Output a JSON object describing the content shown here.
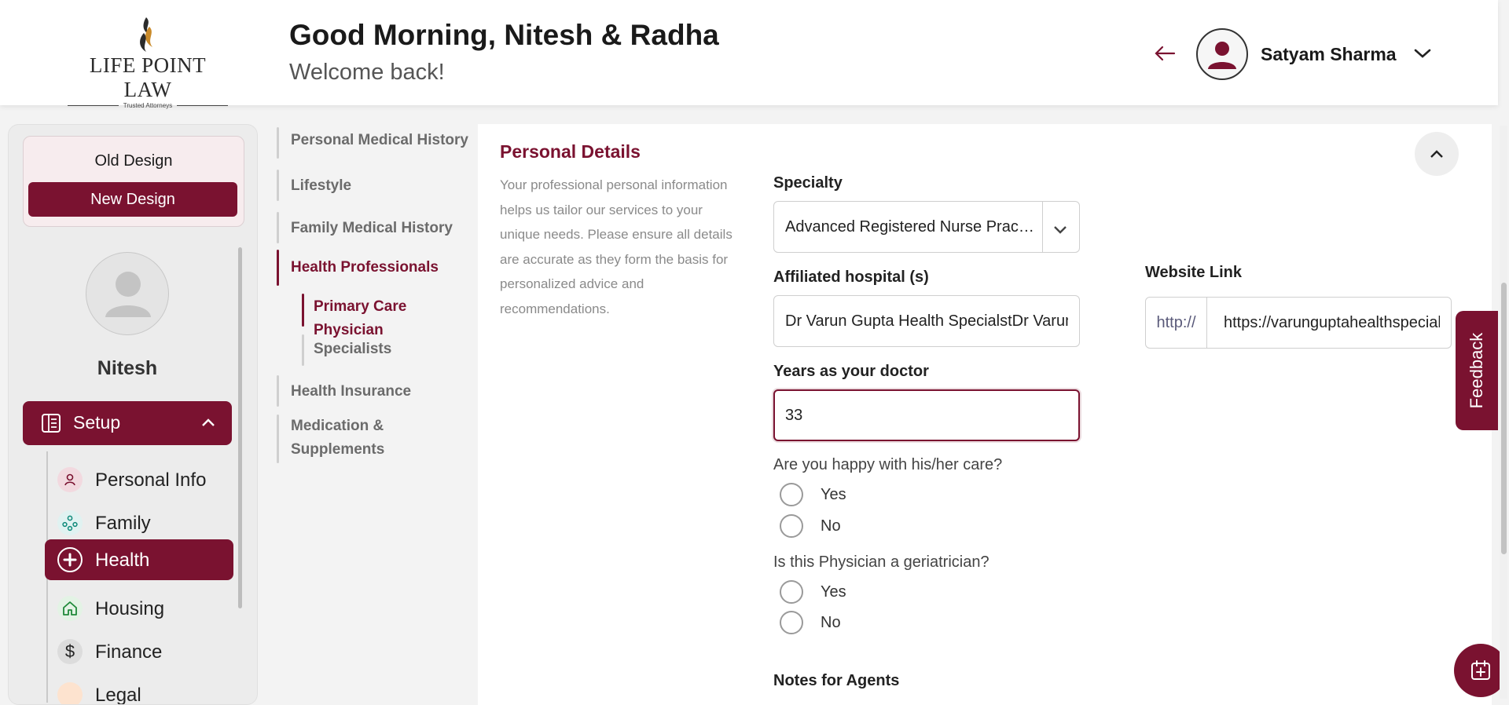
{
  "brand": {
    "logo_text": "LIFE POINT LAW",
    "logo_tagline": "Trusted Attorneys"
  },
  "header": {
    "greeting": "Good Morning, Nitesh & Radha",
    "welcome": "Welcome back!",
    "user_name": "Satyam Sharma"
  },
  "design_toggle": {
    "old": "Old Design",
    "new": "New Design"
  },
  "profile": {
    "name": "Nitesh"
  },
  "sidebar": {
    "setup_label": "Setup",
    "items": [
      {
        "label": "Personal Info",
        "icon": "person-icon"
      },
      {
        "label": "Family",
        "icon": "family-icon"
      },
      {
        "label": "Health",
        "icon": "health-cross-icon",
        "active": true
      },
      {
        "label": "Housing",
        "icon": "house-icon"
      },
      {
        "label": "Finance",
        "icon": "dollar-icon"
      },
      {
        "label": "Legal",
        "icon": "legal-icon"
      }
    ]
  },
  "subnav": {
    "personal_medical_history": "Personal Medical History",
    "lifestyle": "Lifestyle",
    "family_medical_history": "Family Medical History",
    "health_professionals": "Health Professionals",
    "primary_care_physician": "Primary Care Physician",
    "specialists": "Specialists",
    "health_insurance": "Health Insurance",
    "medication_1": "Medication &",
    "medication_2": "Supplements"
  },
  "form": {
    "title": "Personal Details",
    "description": "Your professional personal information helps us tailor our services to your unique needs. Please ensure all details are accurate as they form the basis for personalized advice and recommendations.",
    "specialty_label": "Specialty",
    "specialty_value": "Advanced Registered Nurse Practitioner",
    "hospital_label": "Affiliated hospital (s)",
    "hospital_value": "Dr Varun Gupta Health SpecialstDr Varun Gupta Health Specialst",
    "website_label": "Website Link",
    "website_prefix": "http://",
    "website_value": "https://varunguptahealthspecialist.com",
    "years_label": "Years as your doctor",
    "years_value": "33",
    "happy_question": "Are you happy with his/her care?",
    "geriatrician_question": "Is this Physician a geriatrician?",
    "yes": "Yes",
    "no": "No",
    "notes_label": "Notes for Agents"
  },
  "feedback_label": "Feedback",
  "colors": {
    "accent": "#7a1230"
  }
}
